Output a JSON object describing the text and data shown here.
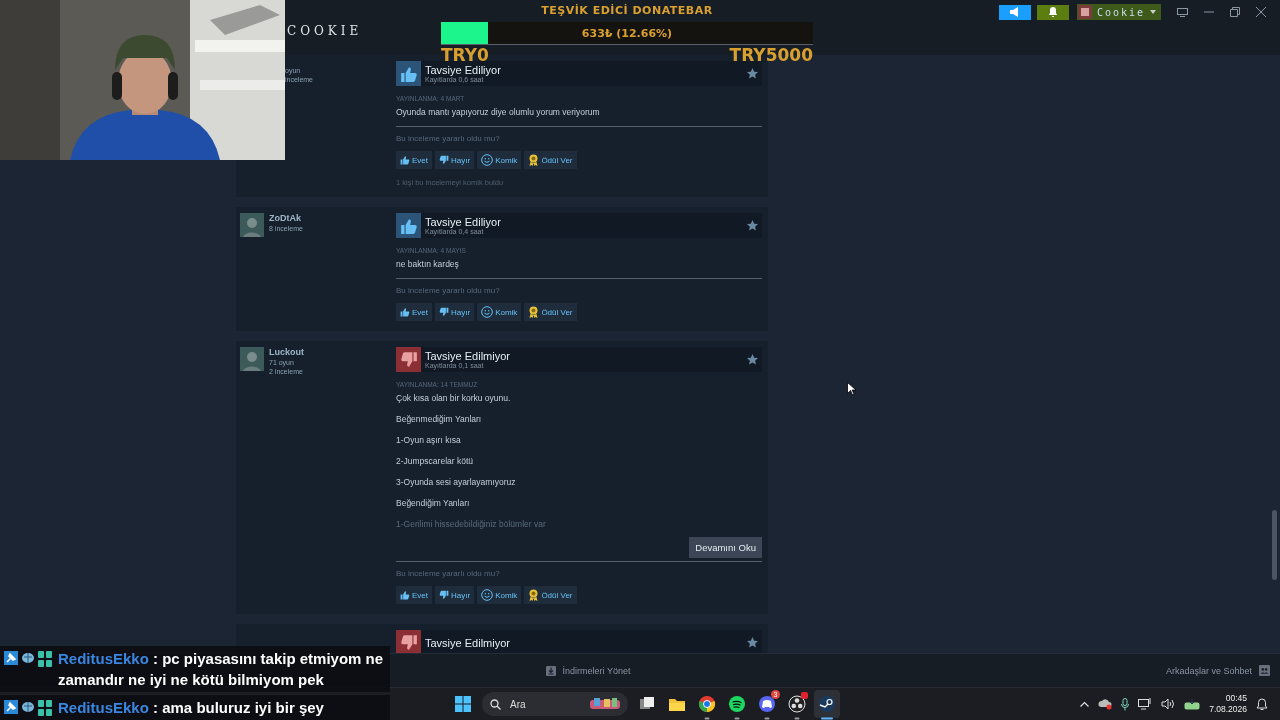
{
  "steam": {
    "title": "COOKIE",
    "account": "Cookie",
    "reviews": [
      {
        "author": {
          "stats": [
            "oyun",
            "inceleme"
          ]
        },
        "recommended": true,
        "title": "Tavsiye Ediliyor",
        "hours": "Kayıtlarda 0,6 saat",
        "date": "YAYINLANMA: 4 MART",
        "body": [
          "Oyunda mantı yapıyoruz diye olumlu yorum veriyorum"
        ],
        "question": "Bu inceleme yararlı oldu mu?",
        "actions": [
          {
            "kind": "yes",
            "label": "Evet"
          },
          {
            "kind": "no",
            "label": "Hayır"
          },
          {
            "kind": "funny",
            "label": "Komik"
          },
          {
            "kind": "award",
            "label": "Ödül Ver"
          }
        ],
        "note": "1 kişi bu incelemeyi komik buldu"
      },
      {
        "author": {
          "name": "ZoDtAk",
          "stats": [
            "8 inceleme"
          ]
        },
        "recommended": true,
        "title": "Tavsiye Ediliyor",
        "hours": "Kayıtlarda 0,4 saat",
        "date": "YAYINLANMA: 4 MAYIS",
        "body": [
          "ne baktın kardeş"
        ],
        "question": "Bu inceleme yararlı oldu mu?",
        "actions": [
          {
            "kind": "yes",
            "label": "Evet"
          },
          {
            "kind": "no",
            "label": "Hayır"
          },
          {
            "kind": "funny",
            "label": "Komik"
          },
          {
            "kind": "award",
            "label": "Ödül Ver"
          }
        ]
      },
      {
        "author": {
          "name": "Luckout",
          "stats": [
            "71 oyun",
            "2 inceleme"
          ]
        },
        "recommended": false,
        "title": "Tavsiye Edilmiyor",
        "hours": "Kayıtlarda 0,1 saat",
        "date": "YAYINLANMA: 14 TEMMUZ",
        "body": [
          "Çok kısa olan bir korku oyunu.",
          "Beğenmediğim Yanları",
          "1-Oyun aşırı kısa",
          "2-Jumpscarelar kötü",
          "3-Oyunda sesi ayarlayamıyoruz",
          "Beğendiğim Yanları",
          "1-Gerilimi hissedebildiğiniz bölümler var"
        ],
        "read_more": "Devamını Oku",
        "question": "Bu inceleme yararlı oldu mu?",
        "actions": [
          {
            "kind": "yes",
            "label": "Evet"
          },
          {
            "kind": "no",
            "label": "Hayır"
          },
          {
            "kind": "funny",
            "label": "Komik"
          },
          {
            "kind": "award",
            "label": "Ödül Ver"
          }
        ]
      },
      {
        "recommended": false,
        "title": "Tavsiye Edilmiyor"
      }
    ],
    "footer": {
      "downloads": "İndirmeleri Yönet",
      "friends": "Arkadaşlar ve Sohbet"
    }
  },
  "donatebar": {
    "title": "TEŞVİK EDİCİ DONATEBAR",
    "amount": "633₺ (12.66%)",
    "level": 0.1266,
    "min": "TRY0",
    "max": "TRY5000"
  },
  "chat": [
    {
      "user": "ReditusEkko",
      "text": ": pc piyasasını takip etmiyom ne zamandır ne iyi ne kötü bilmiyom pek"
    },
    {
      "user": "ReditusEkko",
      "text": ": ama buluruz iyi bir şey"
    }
  ],
  "taskbar": {
    "search": "Ara",
    "apps": [
      {
        "kind": "windows",
        "running": false,
        "active": false
      },
      {
        "kind": "taskview",
        "running": false,
        "active": false
      },
      {
        "kind": "explorer",
        "running": false,
        "active": false
      },
      {
        "kind": "chrome",
        "running": true,
        "active": false
      },
      {
        "kind": "spotify",
        "running": true,
        "active": false
      },
      {
        "kind": "discord",
        "running": true,
        "active": false,
        "badge": "3"
      },
      {
        "kind": "obs",
        "running": true,
        "active": false,
        "dot": true
      },
      {
        "kind": "steam",
        "running": true,
        "active": true
      }
    ],
    "time": "00:45",
    "date": "7.08.2026"
  }
}
